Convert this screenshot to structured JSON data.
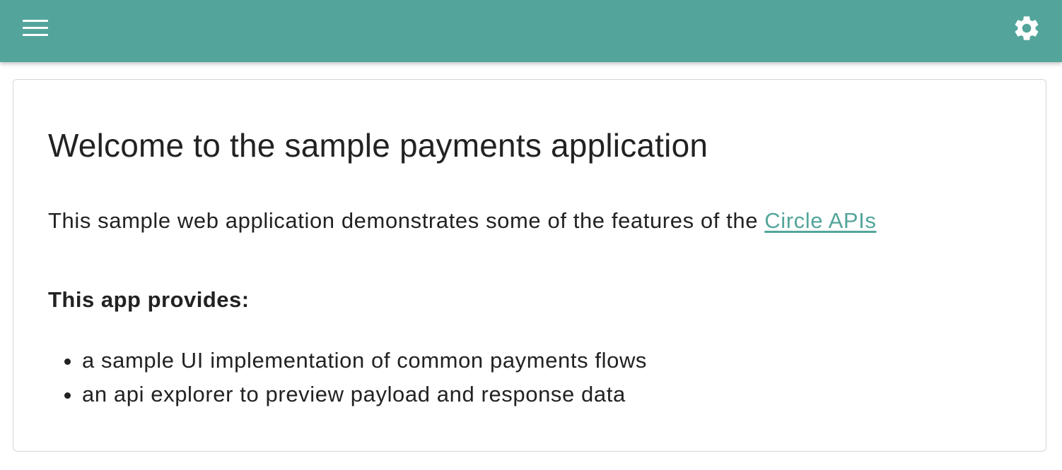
{
  "app_bar": {
    "menu_icon": "hamburger-menu-icon",
    "settings_icon": "gear-icon",
    "background_color": "#53a59b"
  },
  "main": {
    "title": "Welcome to the sample payments application",
    "intro_text": "This sample web application demonstrates some of the features of the ",
    "intro_link": "Circle APIs",
    "provides_heading": "This app provides:",
    "features": [
      "a sample UI implementation of common payments flows",
      "an api explorer to preview payload and response data"
    ],
    "link_color": "#53a59b"
  }
}
